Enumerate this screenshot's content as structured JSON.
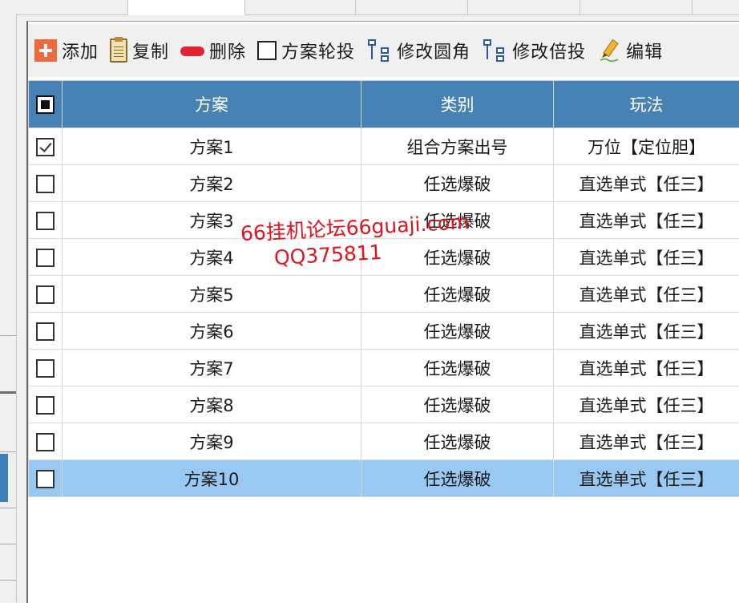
{
  "toolbar": {
    "add": "添加",
    "copy": "复制",
    "delete": "删除",
    "rotate_plans": "方案轮投",
    "modify_corner": "修改圆角",
    "modify_multiplier": "修改倍投",
    "edit": "编辑"
  },
  "grid": {
    "headers": {
      "plan": "方案",
      "category": "类别",
      "mode": "玩法"
    },
    "rows": [
      {
        "plan": "方案1",
        "category": "组合方案出号",
        "mode": "万位【定位胆】",
        "checked": true
      },
      {
        "plan": "方案2",
        "category": "任选爆破",
        "mode": "直选单式【任三】",
        "checked": false
      },
      {
        "plan": "方案3",
        "category": "任选爆破",
        "mode": "直选单式【任三】",
        "checked": false
      },
      {
        "plan": "方案4",
        "category": "任选爆破",
        "mode": "直选单式【任三】",
        "checked": false
      },
      {
        "plan": "方案5",
        "category": "任选爆破",
        "mode": "直选单式【任三】",
        "checked": false
      },
      {
        "plan": "方案6",
        "category": "任选爆破",
        "mode": "直选单式【任三】",
        "checked": false
      },
      {
        "plan": "方案7",
        "category": "任选爆破",
        "mode": "直选单式【任三】",
        "checked": false
      },
      {
        "plan": "方案8",
        "category": "任选爆破",
        "mode": "直选单式【任三】",
        "checked": false
      },
      {
        "plan": "方案9",
        "category": "任选爆破",
        "mode": "直选单式【任三】",
        "checked": false
      },
      {
        "plan": "方案10",
        "category": "任选爆破",
        "mode": "直选单式【任三】",
        "checked": false,
        "selected": true
      }
    ]
  },
  "watermark": {
    "line1": "66挂机论坛66guaji.com",
    "line2": "QQ375811"
  },
  "colors": {
    "header_bg": "#4682b4",
    "selected_row": "#99c9f3",
    "accent_add": "#ee6a3c",
    "accent_delete": "#e0232e",
    "watermark": "#e0141e"
  },
  "icons": [
    "add-icon",
    "clipboard-icon",
    "minus-icon",
    "checkbox-icon",
    "tree-structure-icon",
    "pencil-icon"
  ]
}
